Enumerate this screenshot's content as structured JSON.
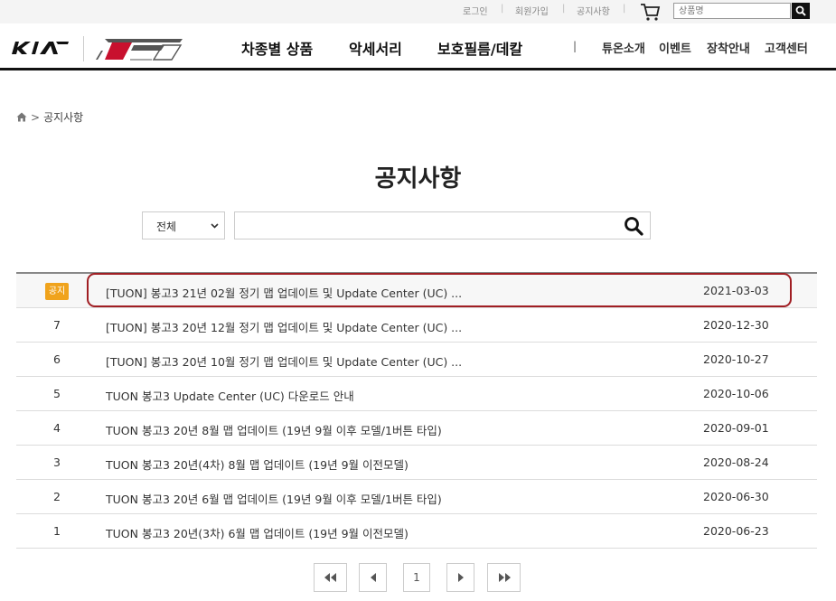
{
  "util": {
    "login": "로그인",
    "signup": "회원가입",
    "notice": "공지사항",
    "search_placeholder": "상품명"
  },
  "header": {
    "nav_main": [
      "차종별 상품",
      "악세서리",
      "보호필름/데칼"
    ],
    "nav_sub": [
      "튜온소개",
      "이벤트",
      "장착안내",
      "고객센터"
    ]
  },
  "breadcrumb": {
    "current": "공지사항"
  },
  "page": {
    "title": "공지사항",
    "filter_value": "전체"
  },
  "board": {
    "badge_label": "공지",
    "rows": [
      {
        "num": "",
        "title": "[TUON] 봉고3 21년 02월 정기 맵 업데이트 및 Update Center (UC) ...",
        "date": "2021-03-03"
      },
      {
        "num": "7",
        "title": "[TUON] 봉고3 20년 12월 정기 맵 업데이트 및 Update Center (UC) ...",
        "date": "2020-12-30"
      },
      {
        "num": "6",
        "title": "[TUON] 봉고3 20년 10월 정기 맵 업데이트 및 Update Center (UC) ...",
        "date": "2020-10-27"
      },
      {
        "num": "5",
        "title": "TUON 봉고3 Update Center (UC) 다운로드 안내",
        "date": "2020-10-06"
      },
      {
        "num": "4",
        "title": "TUON 봉고3 20년 8월 맵 업데이트 (19년 9월 이후 모델/1버튼 타입)",
        "date": "2020-09-01"
      },
      {
        "num": "3",
        "title": "TUON 봉고3 20년(4차) 8월 맵 업데이트 (19년 9월 이전모델)",
        "date": "2020-08-24"
      },
      {
        "num": "2",
        "title": "TUON 봉고3 20년 6월 맵 업데이트 (19년 9월 이후 모델/1버튼 타입)",
        "date": "2020-06-30"
      },
      {
        "num": "1",
        "title": "TUON 봉고3 20년(3차) 6월 맵 업데이트 (19년 9월 이전모델)",
        "date": "2020-06-23"
      }
    ]
  },
  "pagination": {
    "current_page": "1"
  },
  "colors": {
    "badge": "#f0a31c",
    "highlight": "#a01e23",
    "header_rule": "#111111"
  }
}
